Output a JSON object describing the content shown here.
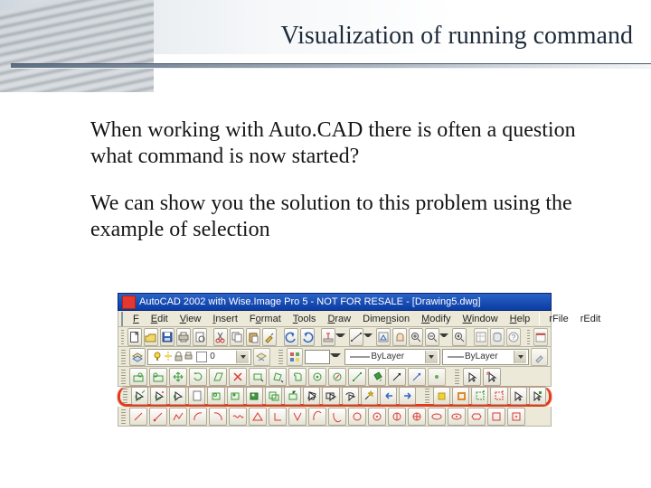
{
  "title": "Visualization of running command",
  "para1": "When working with Auto.CAD there is often a question what command is now started?",
  "para2": "We can show you the solution to this problem using the example of selection",
  "shot": {
    "titlebar": "AutoCAD 2002 with Wise.Image Pro 5 - NOT FOR RESALE - [Drawing5.dwg]",
    "menu": [
      "File",
      "Edit",
      "View",
      "Insert",
      "Format",
      "Tools",
      "Draw",
      "Dimension",
      "Modify",
      "Window",
      "Help",
      "rFile",
      "rEdit"
    ],
    "combo_layer": "♀ □ 0",
    "combo_ltype": "ByLayer",
    "combo_ltype2": "ByLayer",
    "swatches": {
      "bylayer": "#ffffff"
    },
    "row3_icons": [
      "detect",
      "detect2",
      "move",
      "rotate",
      "skew",
      "cross",
      "rect-sel",
      "poly-sel",
      "grab",
      "grab2",
      "grab3",
      "grab4",
      "bucket",
      "vec",
      "vec2",
      "dot",
      "cursor"
    ],
    "row4_icons": [
      "pick",
      "pick-add",
      "pick-all",
      "doc",
      "mask",
      "mask-in",
      "mask-out",
      "mask-clip",
      "attach",
      "poly",
      "rect",
      "lasso",
      "magic",
      "arrow-l",
      "arrow-r",
      "box",
      "add-sel",
      "rm-sel",
      "ptr",
      "ptr-add"
    ],
    "row5_icons": [
      "line",
      "ray",
      "poly",
      "arc",
      "arc2",
      "wave",
      "tri",
      "l",
      "v",
      "arc3",
      "arc4",
      "circle1",
      "circle2",
      "circle3",
      "circle4",
      "ell",
      "ell2",
      "hex",
      "sq",
      "sq2"
    ]
  },
  "colors": {
    "green": "#3a9d3a",
    "red": "#d93a31",
    "blue": "#2d66c4",
    "yellow": "#f2d233",
    "orange": "#e2872b",
    "black": "#2a2a2a"
  }
}
